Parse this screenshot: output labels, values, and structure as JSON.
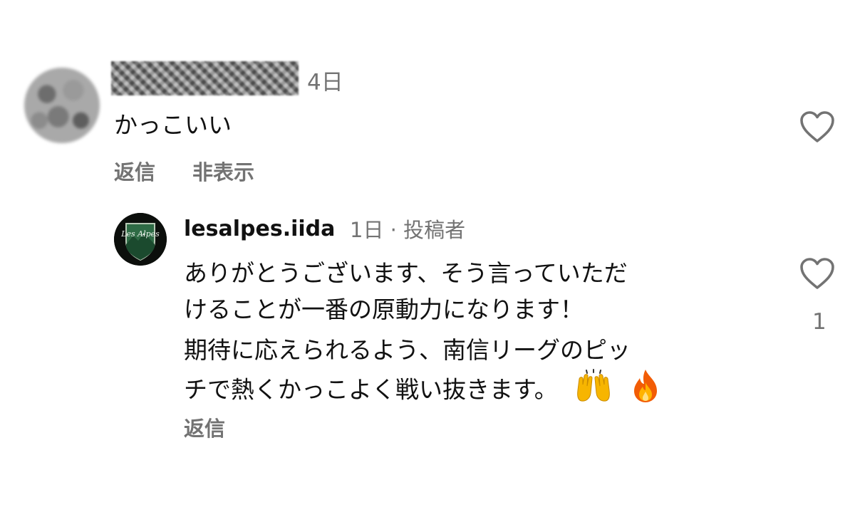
{
  "comment": {
    "time": "4日",
    "text": "かっこいい",
    "actions": {
      "reply": "返信",
      "hide": "非表示"
    },
    "like_icon": "heart-outline-icon"
  },
  "reply": {
    "username": "lesalpes.iida",
    "meta": "1日 · 投稿者",
    "avatar_logo_text": "Les Alpes",
    "paragraphs": [
      [
        "ありがとうございます、そう言っていただ",
        "けることが一番の原動力になります！"
      ],
      [
        "期待に応えられるよう、南信リーグのピッ",
        "チで熱くかっこよく戦い抜きます。"
      ]
    ],
    "emojis": [
      "raising-hands-icon",
      "fire-icon"
    ],
    "actions": {
      "reply": "返信"
    },
    "like_icon": "heart-outline-icon",
    "like_count": "1"
  },
  "colors": {
    "text": "#111111",
    "secondary": "#737373",
    "background": "#ffffff"
  }
}
